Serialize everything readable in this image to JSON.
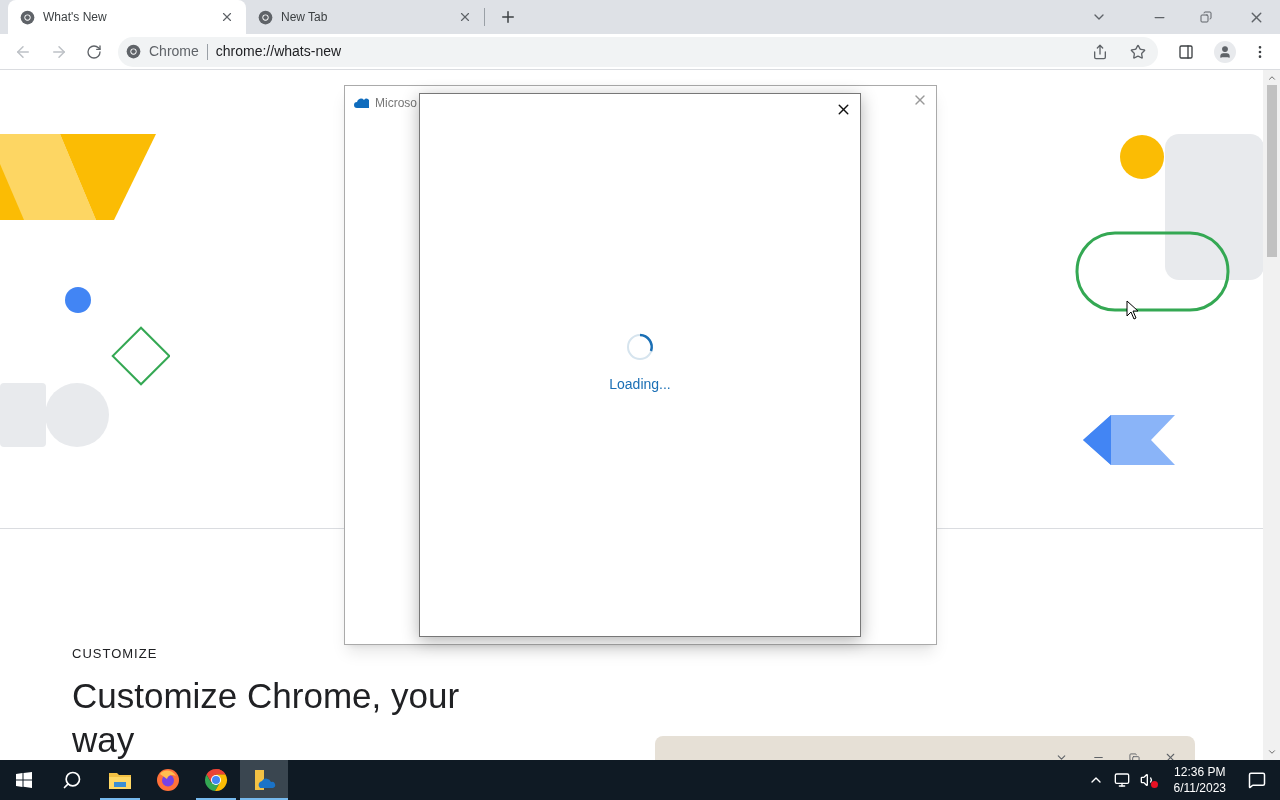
{
  "browser": {
    "tabs": [
      {
        "title": "What's New",
        "selected": true
      },
      {
        "title": "New Tab",
        "selected": false
      }
    ],
    "omnibox": {
      "site_chip": "Chrome",
      "url": "chrome://whats-new"
    }
  },
  "page": {
    "section_label": "CUSTOMIZE",
    "section_title": "Customize Chrome, your way"
  },
  "dialog": {
    "title": "Microso",
    "loading_text": "Loading..."
  },
  "taskbar": {
    "apps": [
      {
        "kind": "explorer",
        "open": true,
        "selected": false
      },
      {
        "kind": "firefox",
        "open": false,
        "selected": false
      },
      {
        "kind": "chrome",
        "open": true,
        "selected": false
      },
      {
        "kind": "onedrive",
        "open": true,
        "selected": true
      }
    ],
    "clock": {
      "time": "12:36 PM",
      "date": "6/11/2023"
    }
  }
}
